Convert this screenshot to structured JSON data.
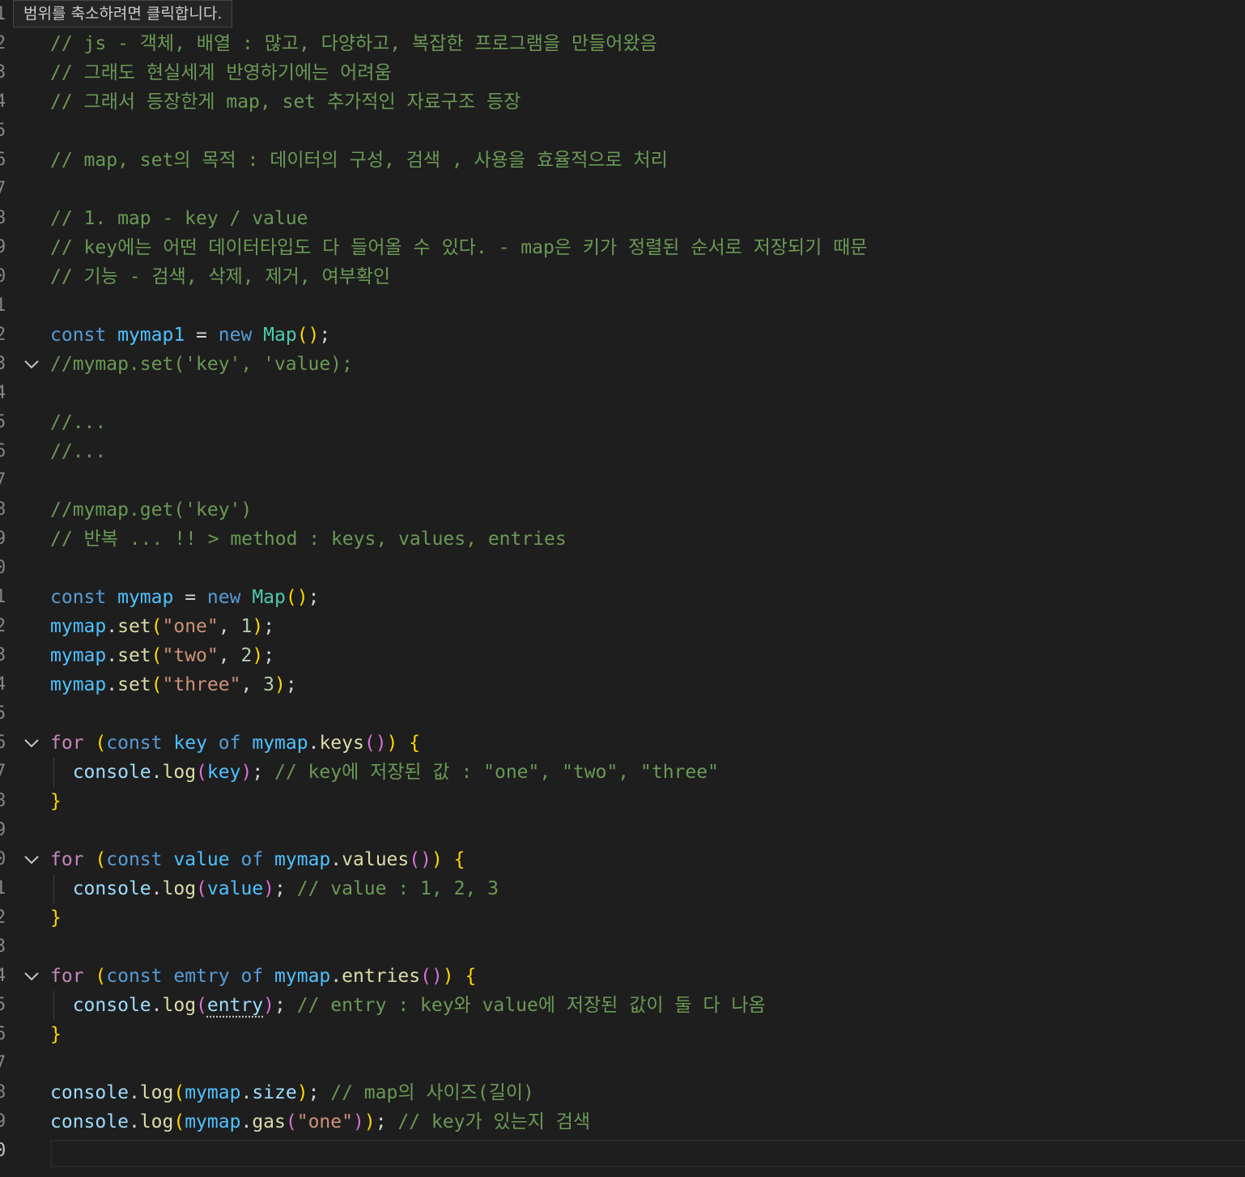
{
  "tooltip": {
    "text": "범위를 축소하려면 클릭합니다."
  },
  "lines": [
    {
      "num": "1",
      "segs": []
    },
    {
      "num": "2",
      "segs": [
        {
          "c": "com",
          "t": "// js - 객체, 배열 : 많고, 다양하고, 복잡한 프로그램을 만들어왔음"
        }
      ]
    },
    {
      "num": "3",
      "segs": [
        {
          "c": "com",
          "t": "// 그래도 현실세계 반영하기에는 어려움"
        }
      ]
    },
    {
      "num": "4",
      "segs": [
        {
          "c": "com",
          "t": "// 그래서 등장한게 map, set 추가적인 자료구조 등장"
        }
      ]
    },
    {
      "num": "5",
      "segs": []
    },
    {
      "num": "6",
      "segs": [
        {
          "c": "com",
          "t": "// map, set의 목적 : 데이터의 구성, 검색 , 사용을 효율적으로 처리"
        }
      ]
    },
    {
      "num": "7",
      "segs": []
    },
    {
      "num": "8",
      "segs": [
        {
          "c": "com",
          "t": "// 1. map - key / value"
        }
      ]
    },
    {
      "num": "9",
      "segs": [
        {
          "c": "com",
          "t": "// key에는 어떤 데이터타입도 다 들어올 수 있다. - map은 키가 정렬된 순서로 저장되기 때문"
        }
      ]
    },
    {
      "num": "0",
      "segs": [
        {
          "c": "com",
          "t": "// 기능 - 검색, 삭제, 제거, 여부확인"
        }
      ]
    },
    {
      "num": "1",
      "segs": []
    },
    {
      "num": "2",
      "segs": [
        {
          "c": "kw",
          "t": "const"
        },
        {
          "c": "pl",
          "t": " "
        },
        {
          "c": "const",
          "t": "mymap1"
        },
        {
          "c": "pl",
          "t": " = "
        },
        {
          "c": "kw",
          "t": "new"
        },
        {
          "c": "pl",
          "t": " "
        },
        {
          "c": "cls",
          "t": "Map"
        },
        {
          "c": "br1",
          "t": "()"
        },
        {
          "c": "pl",
          "t": ";"
        }
      ]
    },
    {
      "num": "3",
      "fold": true,
      "segs": [
        {
          "c": "com",
          "t": "//mymap.set('key', 'value);"
        }
      ]
    },
    {
      "num": "4",
      "segs": []
    },
    {
      "num": "5",
      "segs": [
        {
          "c": "com",
          "t": "//..."
        }
      ]
    },
    {
      "num": "6",
      "segs": [
        {
          "c": "com",
          "t": "//..."
        }
      ]
    },
    {
      "num": "7",
      "segs": []
    },
    {
      "num": "8",
      "segs": [
        {
          "c": "com",
          "t": "//mymap.get('key')"
        }
      ]
    },
    {
      "num": "9",
      "segs": [
        {
          "c": "com",
          "t": "// 반복 ... !! > method : keys, values, entries"
        }
      ]
    },
    {
      "num": "0",
      "segs": []
    },
    {
      "num": "1",
      "segs": [
        {
          "c": "kw",
          "t": "const"
        },
        {
          "c": "pl",
          "t": " "
        },
        {
          "c": "const",
          "t": "mymap"
        },
        {
          "c": "pl",
          "t": " = "
        },
        {
          "c": "kw",
          "t": "new"
        },
        {
          "c": "pl",
          "t": " "
        },
        {
          "c": "cls",
          "t": "Map"
        },
        {
          "c": "br1",
          "t": "()"
        },
        {
          "c": "pl",
          "t": ";"
        }
      ]
    },
    {
      "num": "2",
      "segs": [
        {
          "c": "const",
          "t": "mymap"
        },
        {
          "c": "pl",
          "t": "."
        },
        {
          "c": "fn",
          "t": "set"
        },
        {
          "c": "br1",
          "t": "("
        },
        {
          "c": "str",
          "t": "\"one\""
        },
        {
          "c": "pl",
          "t": ", "
        },
        {
          "c": "num",
          "t": "1"
        },
        {
          "c": "br1",
          "t": ")"
        },
        {
          "c": "pl",
          "t": ";"
        }
      ]
    },
    {
      "num": "3",
      "segs": [
        {
          "c": "const",
          "t": "mymap"
        },
        {
          "c": "pl",
          "t": "."
        },
        {
          "c": "fn",
          "t": "set"
        },
        {
          "c": "br1",
          "t": "("
        },
        {
          "c": "str",
          "t": "\"two\""
        },
        {
          "c": "pl",
          "t": ", "
        },
        {
          "c": "num",
          "t": "2"
        },
        {
          "c": "br1",
          "t": ")"
        },
        {
          "c": "pl",
          "t": ";"
        }
      ]
    },
    {
      "num": "4",
      "segs": [
        {
          "c": "const",
          "t": "mymap"
        },
        {
          "c": "pl",
          "t": "."
        },
        {
          "c": "fn",
          "t": "set"
        },
        {
          "c": "br1",
          "t": "("
        },
        {
          "c": "str",
          "t": "\"three\""
        },
        {
          "c": "pl",
          "t": ", "
        },
        {
          "c": "num",
          "t": "3"
        },
        {
          "c": "br1",
          "t": ")"
        },
        {
          "c": "pl",
          "t": ";"
        }
      ]
    },
    {
      "num": "5",
      "segs": []
    },
    {
      "num": "6",
      "fold": true,
      "segs": [
        {
          "c": "ctl",
          "t": "for"
        },
        {
          "c": "pl",
          "t": " "
        },
        {
          "c": "br1",
          "t": "("
        },
        {
          "c": "kw",
          "t": "const"
        },
        {
          "c": "pl",
          "t": " "
        },
        {
          "c": "const",
          "t": "key"
        },
        {
          "c": "pl",
          "t": " "
        },
        {
          "c": "kw",
          "t": "of"
        },
        {
          "c": "pl",
          "t": " "
        },
        {
          "c": "const",
          "t": "mymap"
        },
        {
          "c": "pl",
          "t": "."
        },
        {
          "c": "fn",
          "t": "keys"
        },
        {
          "c": "br2",
          "t": "()"
        },
        {
          "c": "br1",
          "t": ")"
        },
        {
          "c": "pl",
          "t": " "
        },
        {
          "c": "br1",
          "t": "{"
        }
      ]
    },
    {
      "num": "7",
      "guide": true,
      "segs": [
        {
          "c": "pl",
          "t": "  "
        },
        {
          "c": "var",
          "t": "console"
        },
        {
          "c": "pl",
          "t": "."
        },
        {
          "c": "fn",
          "t": "log"
        },
        {
          "c": "br2",
          "t": "("
        },
        {
          "c": "const",
          "t": "key"
        },
        {
          "c": "br2",
          "t": ")"
        },
        {
          "c": "pl",
          "t": "; "
        },
        {
          "c": "com",
          "t": "// key에 저장된 값 : \"one\", \"two\", \"three\""
        }
      ]
    },
    {
      "num": "8",
      "segs": [
        {
          "c": "br1",
          "t": "}"
        }
      ]
    },
    {
      "num": "9",
      "segs": []
    },
    {
      "num": "0",
      "fold": true,
      "segs": [
        {
          "c": "ctl",
          "t": "for"
        },
        {
          "c": "pl",
          "t": " "
        },
        {
          "c": "br1",
          "t": "("
        },
        {
          "c": "kw",
          "t": "const"
        },
        {
          "c": "pl",
          "t": " "
        },
        {
          "c": "const",
          "t": "value"
        },
        {
          "c": "pl",
          "t": " "
        },
        {
          "c": "kw",
          "t": "of"
        },
        {
          "c": "pl",
          "t": " "
        },
        {
          "c": "const",
          "t": "mymap"
        },
        {
          "c": "pl",
          "t": "."
        },
        {
          "c": "fn",
          "t": "values"
        },
        {
          "c": "br2",
          "t": "()"
        },
        {
          "c": "br1",
          "t": ")"
        },
        {
          "c": "pl",
          "t": " "
        },
        {
          "c": "br1",
          "t": "{"
        }
      ]
    },
    {
      "num": "1",
      "guide": true,
      "segs": [
        {
          "c": "pl",
          "t": "  "
        },
        {
          "c": "var",
          "t": "console"
        },
        {
          "c": "pl",
          "t": "."
        },
        {
          "c": "fn",
          "t": "log"
        },
        {
          "c": "br2",
          "t": "("
        },
        {
          "c": "const",
          "t": "value"
        },
        {
          "c": "br2",
          "t": ")"
        },
        {
          "c": "pl",
          "t": "; "
        },
        {
          "c": "com",
          "t": "// value : 1, 2, 3"
        }
      ]
    },
    {
      "num": "2",
      "segs": [
        {
          "c": "br1",
          "t": "}"
        }
      ]
    },
    {
      "num": "3",
      "segs": []
    },
    {
      "num": "4",
      "fold": true,
      "segs": [
        {
          "c": "ctl",
          "t": "for"
        },
        {
          "c": "pl",
          "t": " "
        },
        {
          "c": "br1",
          "t": "("
        },
        {
          "c": "kw",
          "t": "const"
        },
        {
          "c": "pl",
          "t": " "
        },
        {
          "c": "kw",
          "t": "emtry"
        },
        {
          "c": "pl",
          "t": " "
        },
        {
          "c": "kw",
          "t": "of"
        },
        {
          "c": "pl",
          "t": " "
        },
        {
          "c": "const",
          "t": "mymap"
        },
        {
          "c": "pl",
          "t": "."
        },
        {
          "c": "fn",
          "t": "entries"
        },
        {
          "c": "br2",
          "t": "()"
        },
        {
          "c": "br1",
          "t": ")"
        },
        {
          "c": "pl",
          "t": " "
        },
        {
          "c": "br1",
          "t": "{"
        }
      ]
    },
    {
      "num": "5",
      "guide": true,
      "segs": [
        {
          "c": "pl",
          "t": "  "
        },
        {
          "c": "var",
          "t": "console"
        },
        {
          "c": "pl",
          "t": "."
        },
        {
          "c": "fn",
          "t": "log"
        },
        {
          "c": "br2",
          "t": "("
        },
        {
          "c": "var squiggle",
          "t": "entry"
        },
        {
          "c": "br2",
          "t": ")"
        },
        {
          "c": "pl",
          "t": "; "
        },
        {
          "c": "com",
          "t": "// entry : key와 value에 저장된 값이 둘 다 나옴"
        }
      ]
    },
    {
      "num": "6",
      "segs": [
        {
          "c": "br1",
          "t": "}"
        }
      ]
    },
    {
      "num": "7",
      "segs": []
    },
    {
      "num": "8",
      "segs": [
        {
          "c": "var",
          "t": "console"
        },
        {
          "c": "pl",
          "t": "."
        },
        {
          "c": "fn",
          "t": "log"
        },
        {
          "c": "br1",
          "t": "("
        },
        {
          "c": "const",
          "t": "mymap"
        },
        {
          "c": "pl",
          "t": "."
        },
        {
          "c": "var",
          "t": "size"
        },
        {
          "c": "br1",
          "t": ")"
        },
        {
          "c": "pl",
          "t": "; "
        },
        {
          "c": "com",
          "t": "// map의 사이즈(길이)"
        }
      ]
    },
    {
      "num": "9",
      "segs": [
        {
          "c": "var",
          "t": "console"
        },
        {
          "c": "pl",
          "t": "."
        },
        {
          "c": "fn",
          "t": "log"
        },
        {
          "c": "br1",
          "t": "("
        },
        {
          "c": "const",
          "t": "mymap"
        },
        {
          "c": "pl",
          "t": "."
        },
        {
          "c": "fn",
          "t": "gas"
        },
        {
          "c": "br2",
          "t": "("
        },
        {
          "c": "str",
          "t": "\"one\""
        },
        {
          "c": "br2",
          "t": ")"
        },
        {
          "c": "br1",
          "t": ")"
        },
        {
          "c": "pl",
          "t": "; "
        },
        {
          "c": "com",
          "t": "// key가 있는지 검색"
        }
      ]
    },
    {
      "num": "0",
      "active": true,
      "segs": []
    }
  ]
}
